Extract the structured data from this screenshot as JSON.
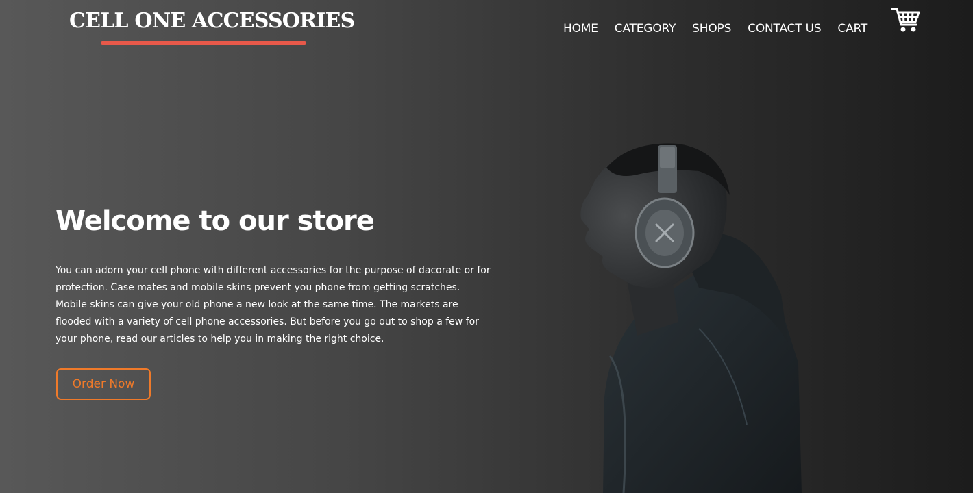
{
  "header": {
    "logo": "CELL ONE ACCESSORIES",
    "nav": [
      "HOME",
      "CATEGORY",
      "SHOPS",
      "CONTACT US",
      "CART"
    ],
    "cart_icon": "shopping-cart-icon"
  },
  "hero": {
    "title": "Welcome to our store",
    "text": "You can adorn your cell phone with different accessories for the purpose of dacorate or for protection. Case mates and mobile skins prevent you phone from getting scratches. Mobile skins can give your old phone a new look at the same time. The markets are flooded with a variety of cell phone accessories. But before you go out to shop a few for your phone, read our articles to help you in making the right choice.",
    "button": "Order Now",
    "image": "man-with-headphones-image"
  },
  "colors": {
    "accent_underline": "#e8594a",
    "button_orange": "#ef7a2a",
    "text": "#ffffff"
  }
}
